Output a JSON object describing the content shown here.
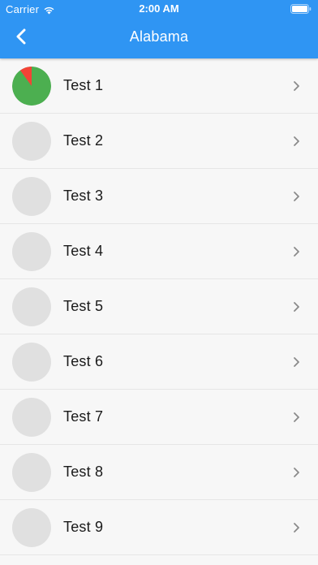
{
  "status_bar": {
    "carrier": "Carrier",
    "time": "2:00 AM"
  },
  "nav": {
    "title": "Alabama"
  },
  "colors": {
    "header": "#2f95f3",
    "progress_complete": "#4caf50",
    "progress_remaining": "#f44336",
    "placeholder_avatar": "#e0e0e0"
  },
  "tests": [
    {
      "label": "Test 1",
      "progress": 0.9
    },
    {
      "label": "Test 2",
      "progress": null
    },
    {
      "label": "Test 3",
      "progress": null
    },
    {
      "label": "Test 4",
      "progress": null
    },
    {
      "label": "Test 5",
      "progress": null
    },
    {
      "label": "Test 6",
      "progress": null
    },
    {
      "label": "Test 7",
      "progress": null
    },
    {
      "label": "Test 8",
      "progress": null
    },
    {
      "label": "Test 9",
      "progress": null
    }
  ]
}
